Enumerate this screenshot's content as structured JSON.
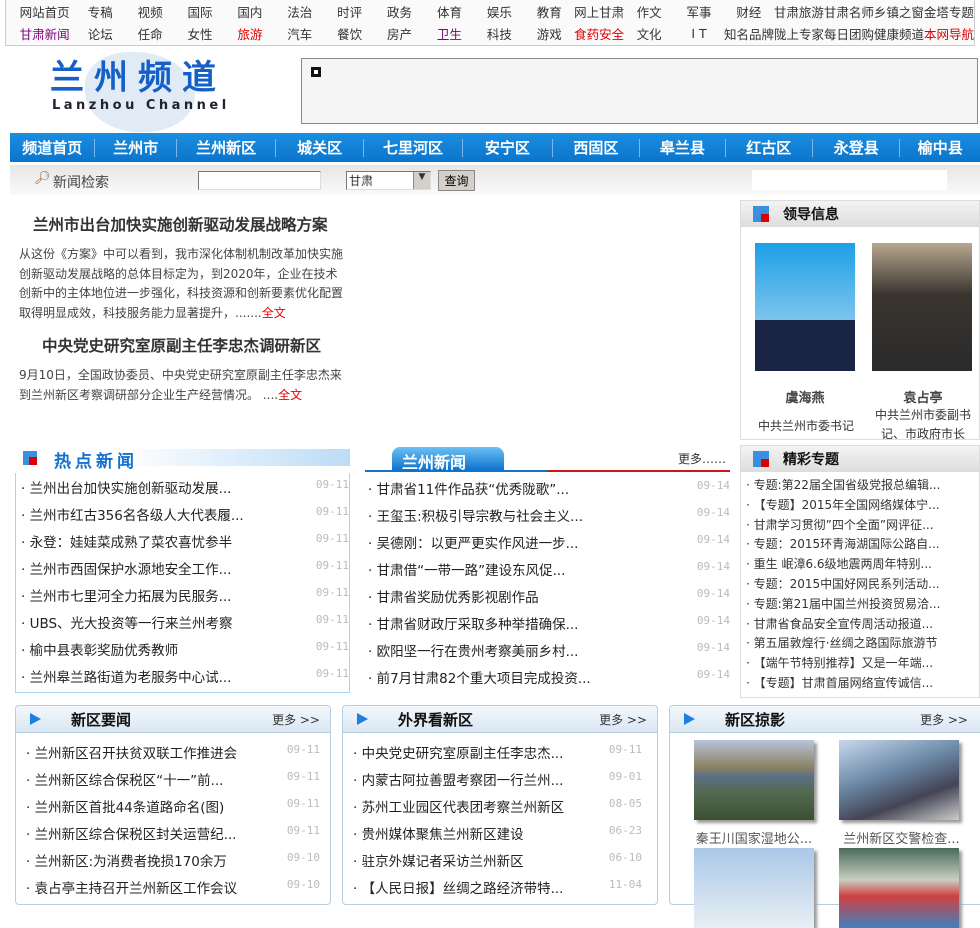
{
  "topnav": {
    "row1": [
      {
        "t": "网站首页"
      },
      {
        "t": "专稿"
      },
      {
        "t": "视频"
      },
      {
        "t": "国际"
      },
      {
        "t": "国内"
      },
      {
        "t": "法治"
      },
      {
        "t": "时评"
      },
      {
        "t": "政务"
      },
      {
        "t": "体育"
      },
      {
        "t": "娱乐"
      },
      {
        "t": "教育"
      },
      {
        "t": "网上甘肃"
      },
      {
        "t": "作文"
      },
      {
        "t": "军事"
      },
      {
        "t": "财经"
      },
      {
        "t": "甘肃旅游"
      },
      {
        "t": "甘肃名师"
      },
      {
        "t": "乡镇之窗"
      },
      {
        "t": "金塔专题"
      }
    ],
    "row2": [
      {
        "t": "甘肃新闻",
        "c": "#800080"
      },
      {
        "t": "论坛"
      },
      {
        "t": "任命"
      },
      {
        "t": "女性"
      },
      {
        "t": "旅游",
        "c": "#e00000"
      },
      {
        "t": "汽车"
      },
      {
        "t": "餐饮"
      },
      {
        "t": "房产"
      },
      {
        "t": "卫生",
        "c": "#800080"
      },
      {
        "t": "科技"
      },
      {
        "t": "游戏"
      },
      {
        "t": "食药安全",
        "c": "#e00000"
      },
      {
        "t": "文化"
      },
      {
        "t": "I T"
      },
      {
        "t": "知名品牌"
      },
      {
        "t": "陇上专家"
      },
      {
        "t": "每日团购"
      },
      {
        "t": "健康频道"
      },
      {
        "t": "本网导航",
        "c": "#e00000"
      }
    ]
  },
  "logo": {
    "cn": "兰州频道",
    "en": "Lanzhou Channel"
  },
  "channels": [
    "频道首页",
    "兰州市",
    "兰州新区",
    "城关区",
    "七里河区",
    "安宁区",
    "西固区",
    "皋兰县",
    "红古区",
    "永登县",
    "榆中县"
  ],
  "search": {
    "label": "新闻检索",
    "value": "",
    "select": "甘肃",
    "button": "查询"
  },
  "headlines": [
    {
      "title": "兰州市出台加快实施创新驱动发展战略方案",
      "summary": "从这份《方案》中可以看到，我市深化体制机制改革加快实施创新驱动发展战略的总体目标定为，到2020年，企业在技术创新中的主体地位进一步强化，科技资源和创新要素优化配置取得明显成效，科技服务能力显著提升，.......",
      "link": "全文"
    },
    {
      "title": "中央党史研究室原副主任李忠杰调研新区",
      "summary": "9月10日，全国政协委员、中央党史研究室原副主任李忠杰来到兰州新区考察调研部分企业生产经营情况。 ....",
      "link": "全文"
    }
  ],
  "leaders": {
    "title": "领导信息",
    "people": [
      {
        "name": "虞海燕",
        "role": "中共兰州市委书记"
      },
      {
        "name": "袁占亭",
        "role": "中共兰州市委副书记、市政府市长"
      }
    ]
  },
  "hot": {
    "title": "热点新闻",
    "items": [
      [
        "兰州出台加快实施创新驱动发展...",
        "09-11"
      ],
      [
        "兰州市红古356名各级人大代表履...",
        "09-11"
      ],
      [
        "永登：娃娃菜成熟了菜农喜忧参半",
        "09-11"
      ],
      [
        "兰州市西固保护水源地安全工作...",
        "09-11"
      ],
      [
        "兰州市七里河全力拓展为民服务...",
        "09-11"
      ],
      [
        "UBS、光大投资等一行来兰州考察",
        "09-11"
      ],
      [
        "榆中县表彰奖励优秀教师",
        "09-11"
      ],
      [
        "兰州皋兰路街道为老服务中心试...",
        "09-11"
      ]
    ]
  },
  "lz": {
    "title": "兰州新闻",
    "more": "更多……",
    "items": [
      [
        "甘肃省11件作品获“优秀陇歌”...",
        "09-14"
      ],
      [
        "王玺玉:积极引导宗教与社会主义...",
        "09-14"
      ],
      [
        "吴德刚：以更严更实作风进一步...",
        "09-14"
      ],
      [
        "甘肃借“一带一路”建设东风促...",
        "09-14"
      ],
      [
        "甘肃省奖励优秀影视剧作品",
        "09-14"
      ],
      [
        "甘肃省财政厅采取多种举措确保...",
        "09-14"
      ],
      [
        "欧阳坚一行在贵州考察美丽乡村...",
        "09-14"
      ],
      [
        "前7月甘肃82个重大项目完成投资...",
        "09-14"
      ]
    ]
  },
  "topics": {
    "title": "精彩专题",
    "items": [
      "专题:第22届全国省级党报总编辑...",
      "【专题】2015年全国网络媒体宁...",
      "甘肃学习贯彻”四个全面”网评征...",
      "专题：2015环青海湖国际公路自...",
      "重生 岷漳6.6级地震两周年特别...",
      "专题：2015中国好网民系列活动...",
      "专题:第21届中国兰州投资贸易洽...",
      "甘肃省食品安全宣传周活动报道...",
      "第五届敦煌行·丝绸之路国际旅游节",
      "【端午节特别推荐】又是一年端...",
      "【专题】甘肃首届网络宣传诚信..."
    ]
  },
  "xq": {
    "title": "新区要闻",
    "more": "更多 >>",
    "items": [
      [
        "兰州新区召开扶贫双联工作推进会",
        "09-11"
      ],
      [
        "兰州新区综合保税区“十一”前...",
        "09-11"
      ],
      [
        "兰州新区首批44条道路命名(图)",
        "09-11"
      ],
      [
        "兰州新区综合保税区封关运营纪...",
        "09-11"
      ],
      [
        "兰州新区:为消费者挽损170余万",
        "09-10"
      ],
      [
        "袁占亭主持召开兰州新区工作会议",
        "09-10"
      ]
    ]
  },
  "wj": {
    "title": "外界看新区",
    "more": "更多 >>",
    "items": [
      [
        "中央党史研究室原副主任李忠杰...",
        "09-11"
      ],
      [
        "内蒙古阿拉善盟考察团一行兰州...",
        "09-01"
      ],
      [
        "苏州工业园区代表团考察兰州新区",
        "08-05"
      ],
      [
        "贵州媒体聚焦兰州新区建设",
        "06-23"
      ],
      [
        "驻京外媒记者采访兰州新区",
        "06-10"
      ],
      [
        "【人民日报】丝绸之路经济带特...",
        "11-04"
      ]
    ]
  },
  "ps": {
    "title": "新区掠影",
    "more": "更多 >>",
    "items": [
      "秦王川国家湿地公...",
      "兰州新区交警检查..."
    ]
  }
}
